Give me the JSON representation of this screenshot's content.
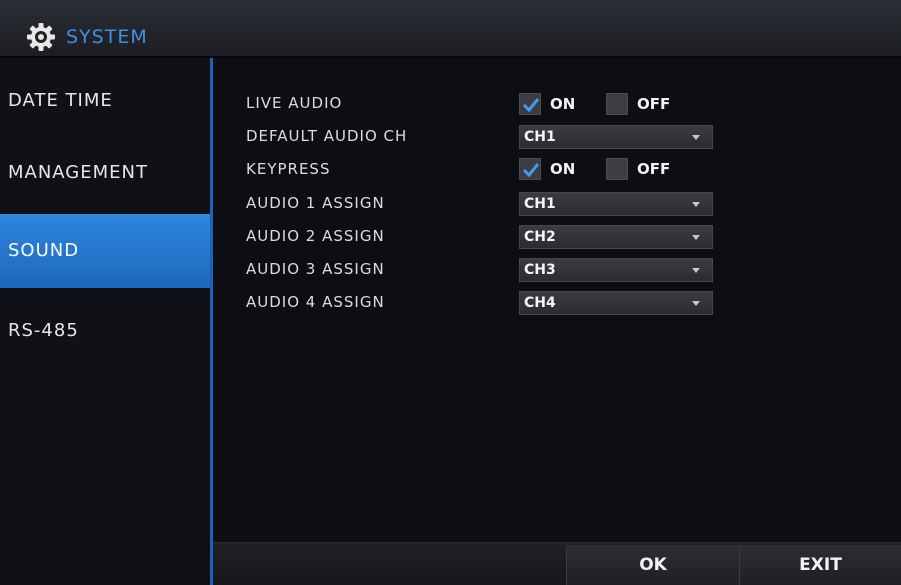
{
  "window": {
    "title": "SYSTEM",
    "accent_color": "#3f8fe6"
  },
  "sidebar": {
    "items": [
      {
        "label": "DATE TIME",
        "active": false
      },
      {
        "label": "MANAGEMENT",
        "active": false
      },
      {
        "label": "SOUND",
        "active": true
      },
      {
        "label": "RS-485",
        "active": false
      }
    ]
  },
  "settings": {
    "live_audio": {
      "label": "LIVE AUDIO",
      "on_label": "ON",
      "off_label": "OFF",
      "on_checked": true,
      "off_checked": false
    },
    "default_audio_ch": {
      "label": "DEFAULT AUDIO CH",
      "value": "CH1"
    },
    "keypress": {
      "label": "KEYPRESS",
      "on_label": "ON",
      "off_label": "OFF",
      "on_checked": true,
      "off_checked": false
    },
    "audio1": {
      "label": "AUDIO 1 ASSIGN",
      "value": "CH1"
    },
    "audio2": {
      "label": "AUDIO 2 ASSIGN",
      "value": "CH2"
    },
    "audio3": {
      "label": "AUDIO 3 ASSIGN",
      "value": "CH3"
    },
    "audio4": {
      "label": "AUDIO 4 ASSIGN",
      "value": "CH4"
    }
  },
  "footer": {
    "ok_label": "OK",
    "exit_label": "EXIT"
  }
}
